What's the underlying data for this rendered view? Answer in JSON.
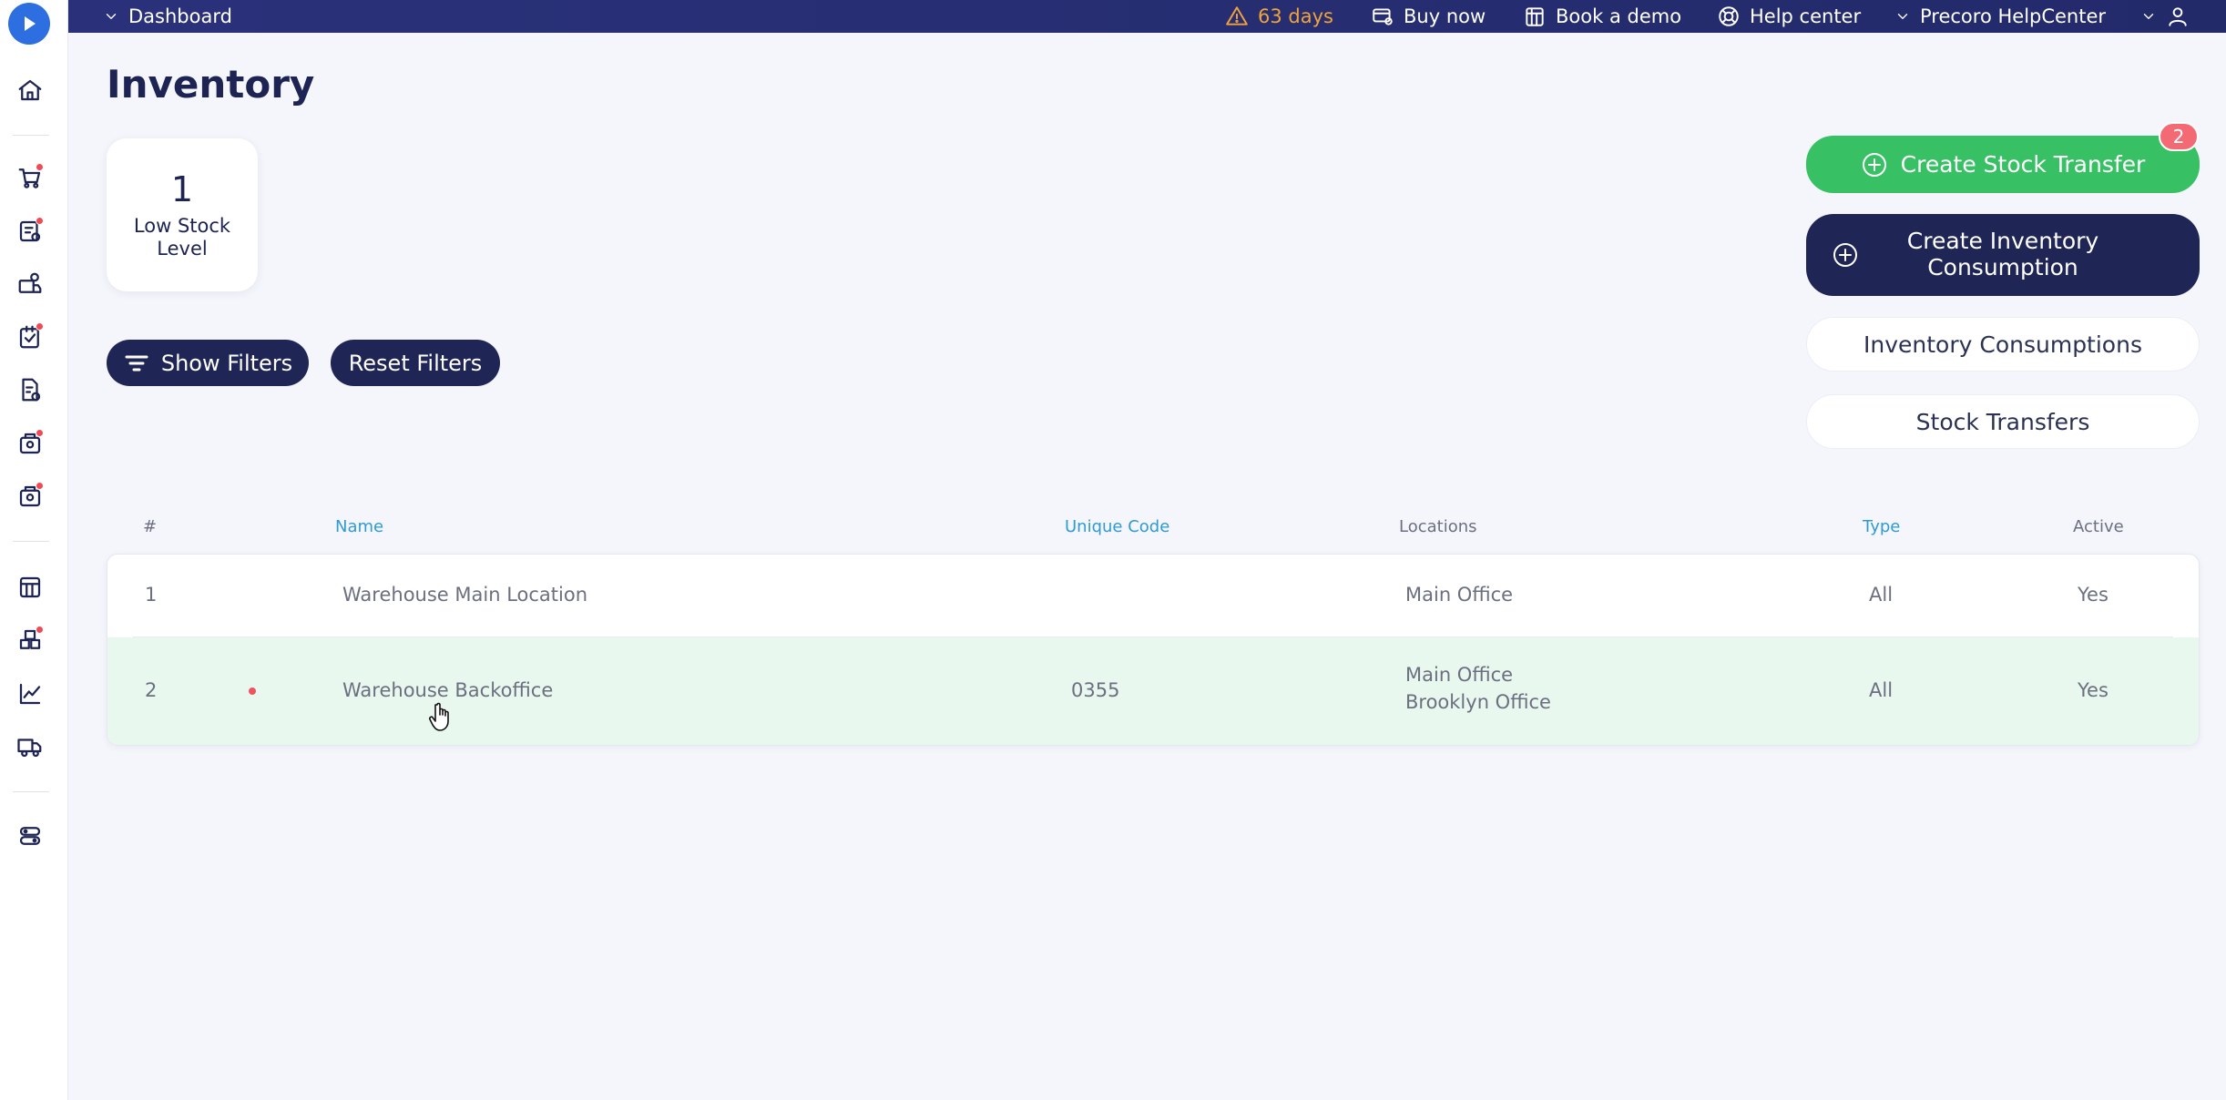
{
  "topbar": {
    "dashboard": "Dashboard",
    "trial": "63 days",
    "buy_now": "Buy now",
    "book_demo": "Book a demo",
    "help_center": "Help center",
    "company": "Precoro HelpCenter"
  },
  "page": {
    "title": "Inventory"
  },
  "stat": {
    "value": "1",
    "label": "Low Stock Level"
  },
  "filters": {
    "show": "Show Filters",
    "reset": "Reset Filters"
  },
  "actions": {
    "create_transfer": "Create Stock Transfer",
    "transfer_badge": "2",
    "create_consumption": "Create Inventory Consumption",
    "consumptions": "Inventory Consumptions",
    "transfers": "Stock Transfers"
  },
  "table": {
    "headers": {
      "num": "#",
      "name": "Name",
      "code": "Unique Code",
      "locations": "Locations",
      "type": "Type",
      "active": "Active"
    },
    "rows": [
      {
        "num": "1",
        "name": "Warehouse Main Location",
        "code": "",
        "locations": [
          "Main Office"
        ],
        "type": "All",
        "active": "Yes",
        "flag": false
      },
      {
        "num": "2",
        "name": "Warehouse Backoffice",
        "code": "0355",
        "locations": [
          "Main Office",
          "Brooklyn Office"
        ],
        "type": "All",
        "active": "Yes",
        "flag": true
      }
    ]
  },
  "colors": {
    "navy": "#1f2555",
    "green": "#38c064",
    "accent_link": "#2f9bd2",
    "warning": "#f0a33a",
    "badge": "#f36a74",
    "highlight_row": "#e8f8ee"
  },
  "sidebar_icons": [
    "home-icon",
    "cart-icon",
    "requests-icon",
    "suppliers-icon",
    "approvals-icon",
    "documents-icon",
    "invoices-icon",
    "payments-icon",
    "budgets-icon",
    "inventory-icon",
    "analytics-icon",
    "delivery-icon",
    "settings-icon"
  ]
}
